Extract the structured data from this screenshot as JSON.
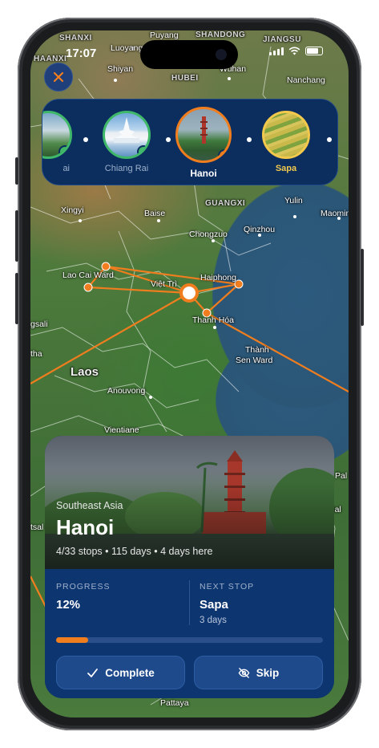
{
  "status": {
    "time": "17:07"
  },
  "map": {
    "labels": [
      {
        "text": "SHANXI",
        "cls": "dim"
      },
      {
        "text": "Puyang",
        "cls": ""
      },
      {
        "text": "SHANDONG",
        "cls": "dim"
      },
      {
        "text": "JIANGSU",
        "cls": "dim"
      },
      {
        "text": "HAANXI",
        "cls": "dim"
      },
      {
        "text": "Luoyang",
        "cls": ""
      },
      {
        "text": "Shiyan",
        "cls": ""
      },
      {
        "text": "HUBEI",
        "cls": "dim"
      },
      {
        "text": "Wuhan",
        "cls": ""
      },
      {
        "text": "Nanchang",
        "cls": ""
      },
      {
        "text": "Xingyi",
        "cls": ""
      },
      {
        "text": "Baise",
        "cls": ""
      },
      {
        "text": "GUANGXI",
        "cls": "dim"
      },
      {
        "text": "Yulin",
        "cls": ""
      },
      {
        "text": "Maoming",
        "cls": ""
      },
      {
        "text": "Chongzuo",
        "cls": ""
      },
      {
        "text": "Qinzhou",
        "cls": ""
      },
      {
        "text": "Lao Cai Ward",
        "cls": ""
      },
      {
        "text": "Việt Trì",
        "cls": ""
      },
      {
        "text": "Haiphong",
        "cls": ""
      },
      {
        "text": "Thanh Hóa",
        "cls": ""
      },
      {
        "text": "Thành",
        "cls": ""
      },
      {
        "text": "Sen Ward",
        "cls": ""
      },
      {
        "text": "Laos",
        "cls": "big"
      },
      {
        "text": "Anouvong",
        "cls": ""
      },
      {
        "text": "Vientiane",
        "cls": ""
      },
      {
        "text": "Pattaya",
        "cls": ""
      },
      {
        "text": "gsali",
        "cls": ""
      },
      {
        "text": "tha",
        "cls": ""
      },
      {
        "text": "tsal",
        "cls": ""
      },
      {
        "text": "Pal",
        "cls": ""
      },
      {
        "text": "Nal",
        "cls": ""
      }
    ]
  },
  "carousel": {
    "stops": [
      {
        "label": "Chiang Rai",
        "state": "done"
      },
      {
        "label": "Hanoi",
        "state": "active"
      },
      {
        "label": "Sapa",
        "state": "next"
      }
    ],
    "partial_label": "ai"
  },
  "card": {
    "region": "Southeast Asia",
    "city": "Hanoi",
    "meta": "4/33 stops • 115 days • 4 days here",
    "progress": {
      "label": "PROGRESS",
      "value": "12%",
      "fraction": 0.12
    },
    "next_stop": {
      "label": "NEXT STOP",
      "name": "Sapa",
      "duration": "3 days"
    },
    "buttons": {
      "complete": "Complete",
      "skip": "Skip"
    }
  },
  "colors": {
    "accent": "#f07d1e",
    "card_bg": "#0d3570",
    "done": "#3fb86a",
    "next": "#f2c94c"
  }
}
